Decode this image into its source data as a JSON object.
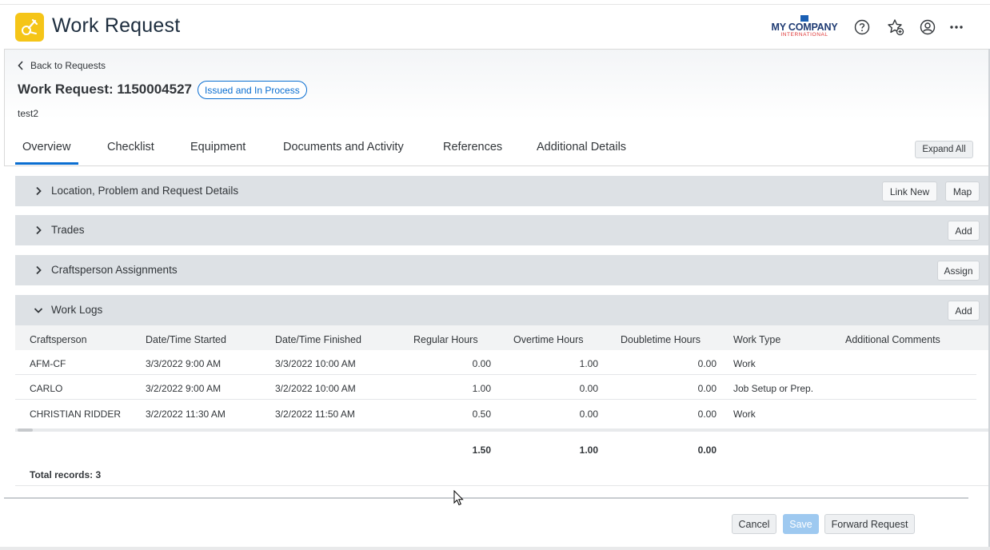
{
  "app": {
    "title": "Work Request",
    "company_name": "MY COMPANY",
    "company_sub": "INTERNATIONAL"
  },
  "header": {
    "back_label": "Back to Requests",
    "title": "Work Request: 1150004527",
    "status": "Issued and In Process",
    "description": "test2"
  },
  "tabs": [
    {
      "label": "Overview"
    },
    {
      "label": "Checklist"
    },
    {
      "label": "Equipment"
    },
    {
      "label": "Documents and Activity"
    },
    {
      "label": "References"
    },
    {
      "label": "Additional Details"
    }
  ],
  "expand_all_label": "Expand All",
  "sections": {
    "location": {
      "label": "Location, Problem and Request Details",
      "btn_link_new": "Link New",
      "btn_map": "Map"
    },
    "trades": {
      "label": "Trades",
      "btn_add": "Add"
    },
    "craftsperson": {
      "label": "Craftsperson Assignments",
      "btn_assign": "Assign"
    },
    "worklogs": {
      "label": "Work Logs",
      "btn_add": "Add"
    }
  },
  "worklogs": {
    "columns": [
      "Craftsperson",
      "Date/Time Started",
      "Date/Time Finished",
      "Regular Hours",
      "Overtime Hours",
      "Doubletime Hours",
      "Work Type",
      "Additional Comments"
    ],
    "rows": [
      {
        "craftsperson": "AFM-CF",
        "started": "3/3/2022 9:00 AM",
        "finished": "3/3/2022 10:00 AM",
        "regular": "0.00",
        "overtime": "1.00",
        "doubletime": "0.00",
        "work_type": "Work",
        "comments": ""
      },
      {
        "craftsperson": "CARLO",
        "started": "3/2/2022 9:00 AM",
        "finished": "3/2/2022 10:00 AM",
        "regular": "1.00",
        "overtime": "0.00",
        "doubletime": "0.00",
        "work_type": "Job Setup or Prep.",
        "comments": ""
      },
      {
        "craftsperson": "CHRISTIAN RIDDER",
        "started": "3/2/2022 11:30 AM",
        "finished": "3/2/2022 11:50 AM",
        "regular": "0.50",
        "overtime": "0.00",
        "doubletime": "0.00",
        "work_type": "Work",
        "comments": ""
      }
    ],
    "totals": {
      "regular": "1.50",
      "overtime": "1.00",
      "doubletime": "0.00"
    },
    "total_records": "Total records: 3"
  },
  "footer": {
    "cancel": "Cancel",
    "save": "Save",
    "forward": "Forward Request"
  },
  "colors": {
    "accent": "#0a6ed1",
    "app_icon": "#f5c518",
    "section_bg": "#dde1e5"
  }
}
